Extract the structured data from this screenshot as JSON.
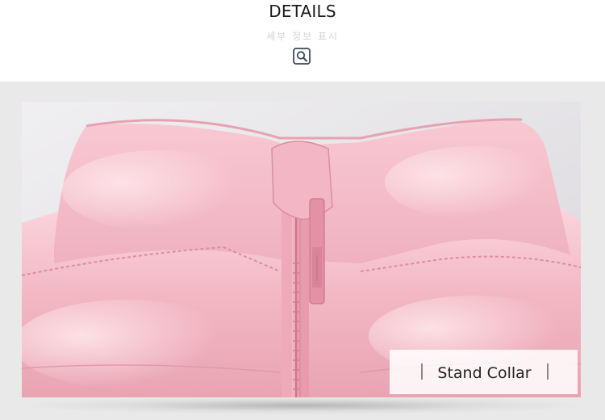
{
  "header": {
    "title": "DETAILS",
    "subtitle": "세부 정보 표시",
    "zoom_icon": "magnifier-icon"
  },
  "product_image": {
    "caption": "Stand Collar",
    "colors": {
      "fabric": "#f4c0cb",
      "background_wall": "#e9e9e9"
    }
  }
}
